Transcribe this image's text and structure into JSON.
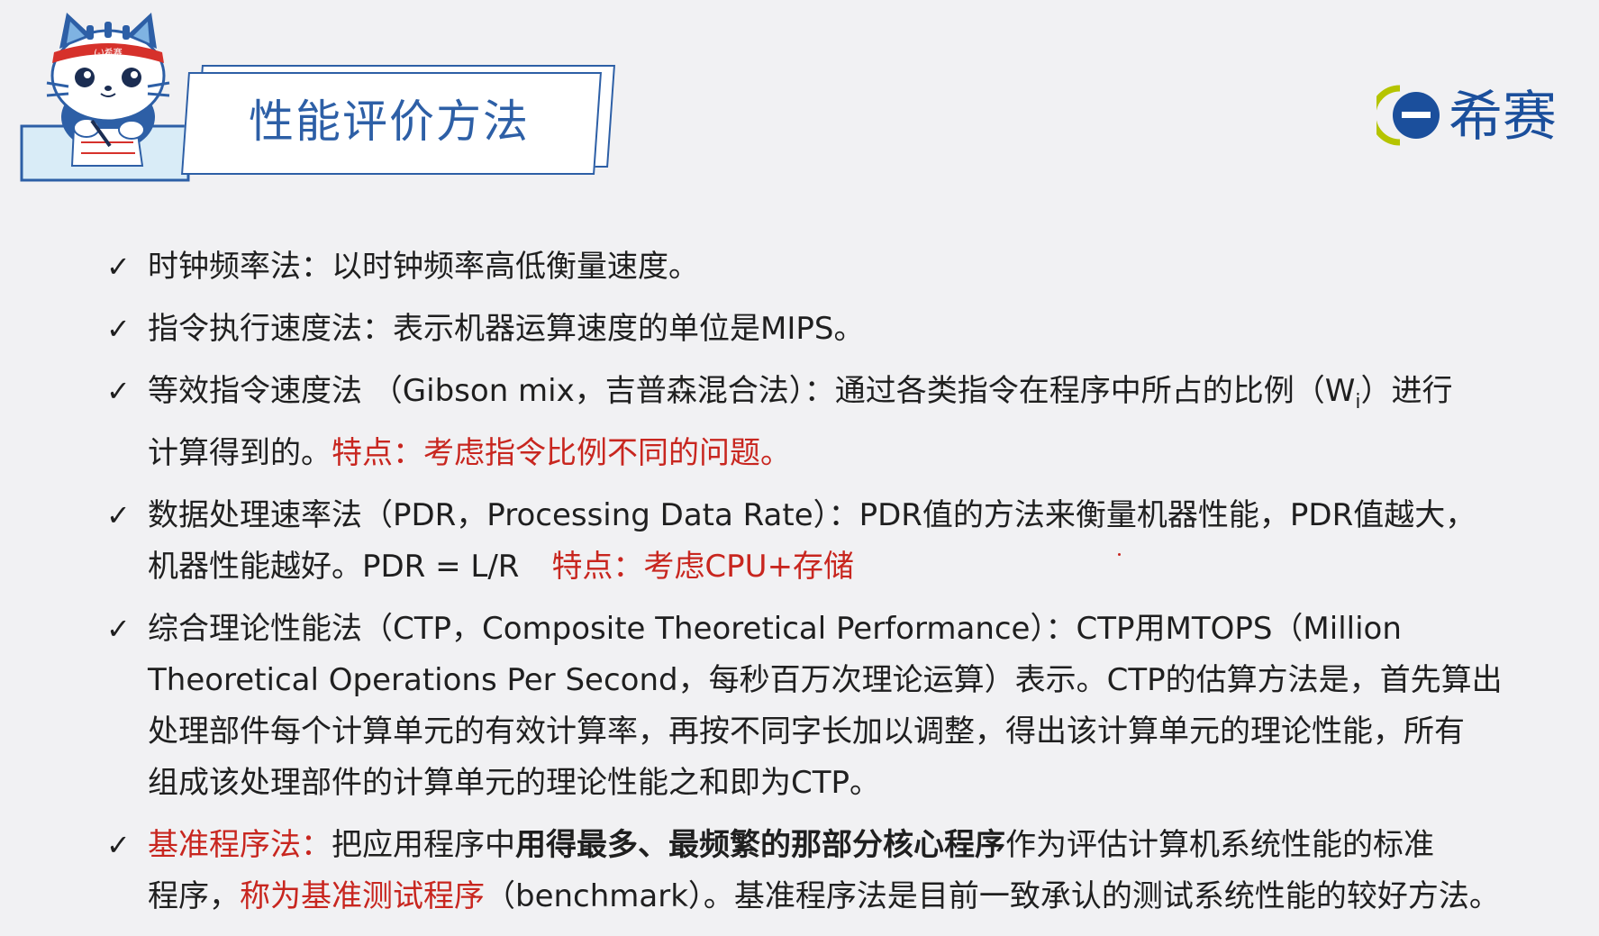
{
  "header": {
    "title": "性能评价方法",
    "mascot_badge": "希赛",
    "logo_text": "希赛"
  },
  "colors": {
    "accent_blue": "#2d5fa6",
    "highlight_red": "#c8261f",
    "logo_green": "#b5c400"
  },
  "items": [
    {
      "check": "✓",
      "lines": [
        [
          "时钟频率法：以时钟频率高低衡量速度。"
        ]
      ]
    },
    {
      "check": "✓",
      "lines": [
        [
          "指令执行速度法：表示机器运算速度的单位是MIPS。"
        ]
      ]
    },
    {
      "check": "✓",
      "lines": [
        [
          "等效指令速度法 （Gibson mix，吉普森混合法）：通过各类指令在程序中所占的比例（W",
          "i",
          "）进行"
        ],
        [
          "计算得到的。",
          "特点：考虑指令比例不同的问题。"
        ]
      ]
    },
    {
      "check": "✓",
      "lines": [
        [
          "数据处理速率法（PDR，Processing Data Rate）：PDR值的方法来衡量机器性能，PDR值越大，"
        ],
        [
          "机器性能越好。PDR = L/R",
          "特点：考虑CPU+存储"
        ]
      ]
    },
    {
      "check": "✓",
      "lines": [
        [
          "综合理论性能法（CTP，Composite Theoretical Performance）：CTP用MTOPS（Million"
        ],
        [
          "Theoretical Operations Per Second，每秒百万次理论运算）表示。CTP的估算方法是，首先算出"
        ],
        [
          "处理部件每个计算单元的有效计算率，再按不同字长加以调整，得出该计算单元的理论性能，所有"
        ],
        [
          "组成该处理部件的计算单元的理论性能之和即为CTP。"
        ]
      ]
    },
    {
      "check": "✓",
      "lines": [
        [
          "基准程序法：",
          "把应用程序中",
          "用得最多、最频繁的那部分核心程序",
          "作为评估计算机系统性能的标准"
        ],
        [
          "程序，",
          "称为基准测试程序",
          "（benchmark）。基准程序法是目前一致承认的测试系统性能的较好方法。"
        ]
      ]
    }
  ]
}
